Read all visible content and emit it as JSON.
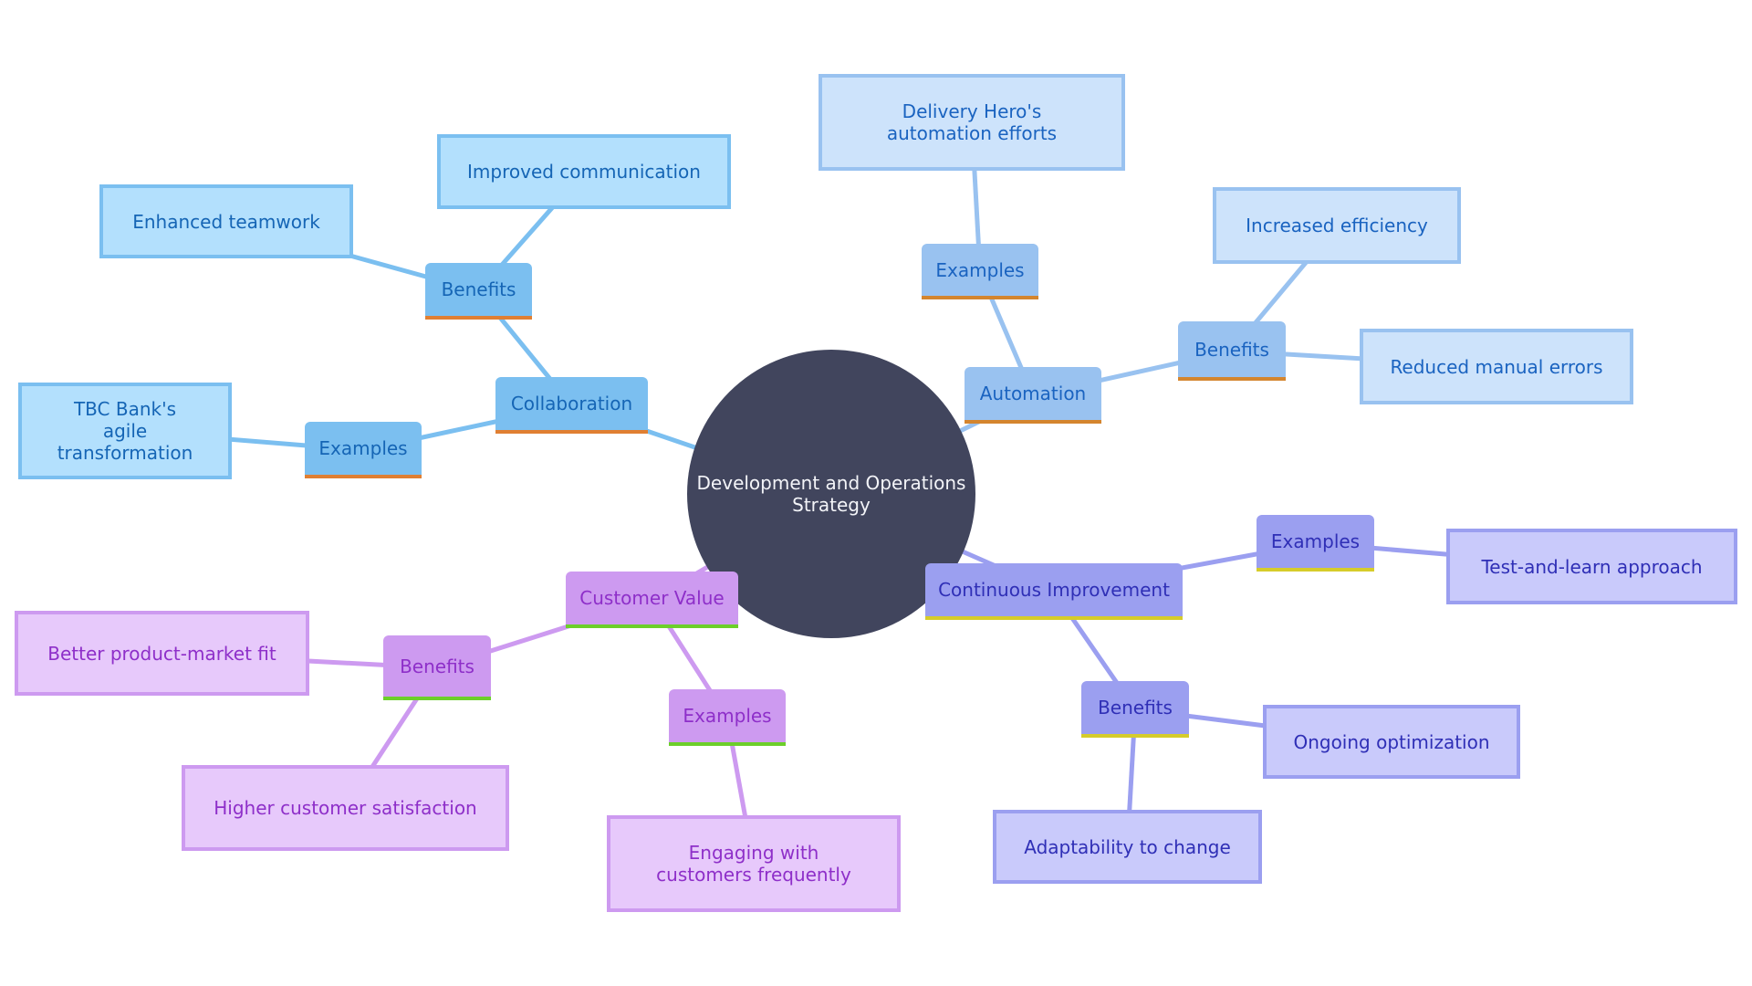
{
  "diagram": {
    "type": "mindmap",
    "root": {
      "id": "root",
      "label": "Development and Operations Strategy"
    },
    "colors": {
      "root_fill": "#41455d",
      "collaboration": {
        "branch": "#7bbff0",
        "leaf": "#b3e0fd",
        "text": "#1565b5",
        "accent": "#e07f32"
      },
      "automation": {
        "branch": "#99c2f0",
        "leaf": "#cde3fb",
        "text": "#1a63c0",
        "accent": "#d4852e"
      },
      "continuous_improvement": {
        "branch": "#9b9ff0",
        "leaf": "#c9cafb",
        "text": "#2f2fb6",
        "accent": "#d6cc2a"
      },
      "customer_value": {
        "branch": "#cd9af0",
        "leaf": "#e7c9fb",
        "text": "#8e2fc9",
        "accent": "#6ccf2a"
      }
    },
    "nodes": [
      {
        "id": "collab",
        "label": "Collaboration",
        "parent": "root",
        "kind": "branch",
        "group": "c-collab"
      },
      {
        "id": "collab-benefits",
        "label": "Benefits",
        "parent": "collab",
        "kind": "branch",
        "group": "c-collab"
      },
      {
        "id": "collab-benefit-1",
        "label": "Enhanced teamwork",
        "parent": "collab-benefits",
        "kind": "leaf",
        "group": "c-collab"
      },
      {
        "id": "collab-benefit-2",
        "label": "Improved communication",
        "parent": "collab-benefits",
        "kind": "leaf",
        "group": "c-collab"
      },
      {
        "id": "collab-examples",
        "label": "Examples",
        "parent": "collab",
        "kind": "branch",
        "group": "c-collab"
      },
      {
        "id": "collab-example-1",
        "label": "TBC Bank's agile transformation",
        "parent": "collab-examples",
        "kind": "leaf",
        "group": "c-collab"
      },
      {
        "id": "auto",
        "label": "Automation",
        "parent": "root",
        "kind": "branch",
        "group": "c-auto"
      },
      {
        "id": "auto-examples",
        "label": "Examples",
        "parent": "auto",
        "kind": "branch",
        "group": "c-auto"
      },
      {
        "id": "auto-example-1",
        "label": "Delivery Hero's automation efforts",
        "parent": "auto-examples",
        "kind": "leaf",
        "group": "c-auto"
      },
      {
        "id": "auto-benefits",
        "label": "Benefits",
        "parent": "auto",
        "kind": "branch",
        "group": "c-auto"
      },
      {
        "id": "auto-benefit-1",
        "label": "Increased efficiency",
        "parent": "auto-benefits",
        "kind": "leaf",
        "group": "c-auto"
      },
      {
        "id": "auto-benefit-2",
        "label": "Reduced manual errors",
        "parent": "auto-benefits",
        "kind": "leaf",
        "group": "c-auto"
      },
      {
        "id": "ci",
        "label": "Continuous Improvement",
        "parent": "root",
        "kind": "branch",
        "group": "c-ci"
      },
      {
        "id": "ci-examples",
        "label": "Examples",
        "parent": "ci",
        "kind": "branch",
        "group": "c-ci"
      },
      {
        "id": "ci-example-1",
        "label": "Test-and-learn approach",
        "parent": "ci-examples",
        "kind": "leaf",
        "group": "c-ci"
      },
      {
        "id": "ci-benefits",
        "label": "Benefits",
        "parent": "ci",
        "kind": "branch",
        "group": "c-ci"
      },
      {
        "id": "ci-benefit-1",
        "label": "Ongoing optimization",
        "parent": "ci-benefits",
        "kind": "leaf",
        "group": "c-ci"
      },
      {
        "id": "ci-benefit-2",
        "label": "Adaptability to change",
        "parent": "ci-benefits",
        "kind": "leaf",
        "group": "c-ci"
      },
      {
        "id": "cv",
        "label": "Customer Value",
        "parent": "root",
        "kind": "branch",
        "group": "c-cv"
      },
      {
        "id": "cv-benefits",
        "label": "Benefits",
        "parent": "cv",
        "kind": "branch",
        "group": "c-cv"
      },
      {
        "id": "cv-benefit-1",
        "label": "Better product-market fit",
        "parent": "cv-benefits",
        "kind": "leaf",
        "group": "c-cv"
      },
      {
        "id": "cv-benefit-2",
        "label": "Higher customer satisfaction",
        "parent": "cv-benefits",
        "kind": "leaf",
        "group": "c-cv"
      },
      {
        "id": "cv-examples",
        "label": "Examples",
        "parent": "cv",
        "kind": "branch",
        "group": "c-cv"
      },
      {
        "id": "cv-example-1",
        "label": "Engaging with customers frequently",
        "parent": "cv-examples",
        "kind": "leaf",
        "group": "c-cv"
      }
    ]
  }
}
